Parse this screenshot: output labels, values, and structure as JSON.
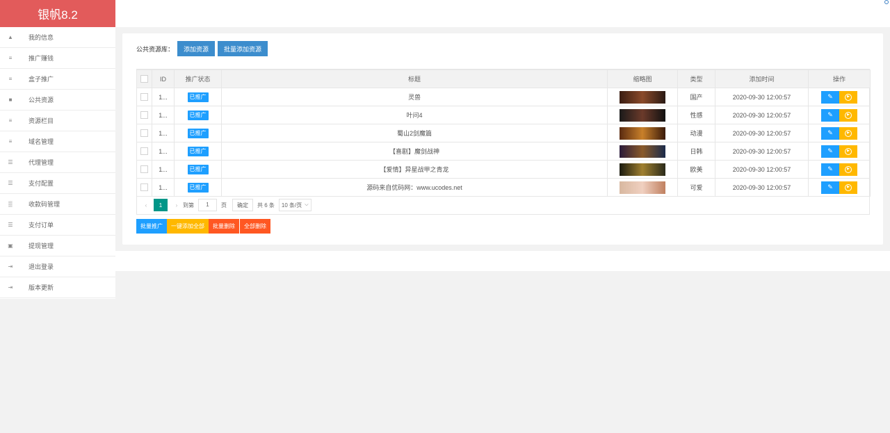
{
  "app": {
    "title": "银帆8.2"
  },
  "sidebar": {
    "items": [
      {
        "label": "我的信息",
        "icon": "user-icon"
      },
      {
        "label": "推广赚钱",
        "icon": "list-icon"
      },
      {
        "label": "盒子推广",
        "icon": "list-icon"
      },
      {
        "label": "公共资源",
        "icon": "video-icon"
      },
      {
        "label": "资源栏目",
        "icon": "list-icon"
      },
      {
        "label": "域名管理",
        "icon": "list-icon"
      },
      {
        "label": "代理管理",
        "icon": "bullet-list-icon"
      },
      {
        "label": "支付配置",
        "icon": "bullet-list-icon"
      },
      {
        "label": "收款码管理",
        "icon": "qrcode-icon"
      },
      {
        "label": "支付订单",
        "icon": "bullet-list-icon"
      },
      {
        "label": "提现管理",
        "icon": "money-icon"
      },
      {
        "label": "退出登录",
        "icon": "sign-in-icon"
      },
      {
        "label": "版本更新",
        "icon": "sign-in-icon"
      }
    ]
  },
  "toolbar": {
    "label": "公共资源库：",
    "add_label": "添加资源",
    "bulk_add_label": "批量添加资源"
  },
  "table": {
    "columns": [
      "ID",
      "推广状态",
      "标题",
      "缩略图",
      "类型",
      "添加时间",
      "操作"
    ],
    "rows": [
      {
        "id": "1...",
        "status": "已推广",
        "title": "灵兽",
        "type": "国产",
        "time": "2020-09-30 12:00:57"
      },
      {
        "id": "1...",
        "status": "已推广",
        "title": "叶问4",
        "type": "性感",
        "time": "2020-09-30 12:00:57"
      },
      {
        "id": "1...",
        "status": "已推广",
        "title": "蜀山2剑魔篇",
        "type": "动漫",
        "time": "2020-09-30 12:00:57"
      },
      {
        "id": "1...",
        "status": "已推广",
        "title": "【喜剧】魔剑战神",
        "type": "日韩",
        "time": "2020-09-30 12:00:57"
      },
      {
        "id": "1...",
        "status": "已推广",
        "title": "【爱情】异星战甲之青龙",
        "type": "欧美",
        "time": "2020-09-30 12:00:57"
      },
      {
        "id": "1...",
        "status": "已推广",
        "title": "源码来自优码网：www.ucodes.net",
        "type": "可爱",
        "time": "2020-09-30 12:00:57"
      }
    ]
  },
  "pager": {
    "current": "1",
    "goto_label": "到第",
    "input_value": "1",
    "page_unit": "页",
    "confirm_label": "确定",
    "total_label": "共 6 条",
    "per_page": "10 条/页"
  },
  "bulk_actions": {
    "promote": "批量推广",
    "add_all": "一键添加全部",
    "delete": "批量删除",
    "delete_all": "全部删除"
  },
  "colors": {
    "brand": "#e25b5b",
    "primary": "#3c8dcd",
    "tag": "#1e9fff",
    "warn": "#ffb800",
    "danger": "#ff5722",
    "pager_active": "#009688"
  }
}
